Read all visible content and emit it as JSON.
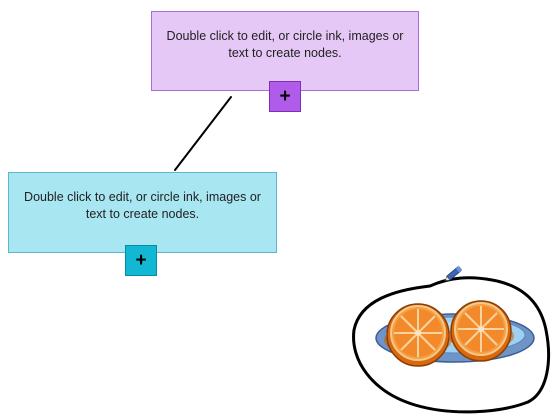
{
  "canvas": {
    "nodes": [
      {
        "id": "purple-node",
        "text": "Double click to edit, or circle ink, images or text to create nodes.",
        "color": "#e6c8f7",
        "border_color": "#a670d6",
        "add_button": {
          "label": "+",
          "color": "#b05be9"
        }
      },
      {
        "id": "cyan-node",
        "text": "Double click to edit, or circle ink, images or text to create nodes.",
        "color": "#a8e6f2",
        "border_color": "#5cb8cc",
        "add_button": {
          "label": "+",
          "color": "#12b7d3"
        }
      }
    ],
    "connector": {
      "color": "#000000",
      "from": "purple-node",
      "to": "cyan-node"
    },
    "ink": {
      "lasso_color": "#000000",
      "pen_cursor_icon": "pen-icon",
      "image": "orange-slices-on-plate"
    }
  }
}
